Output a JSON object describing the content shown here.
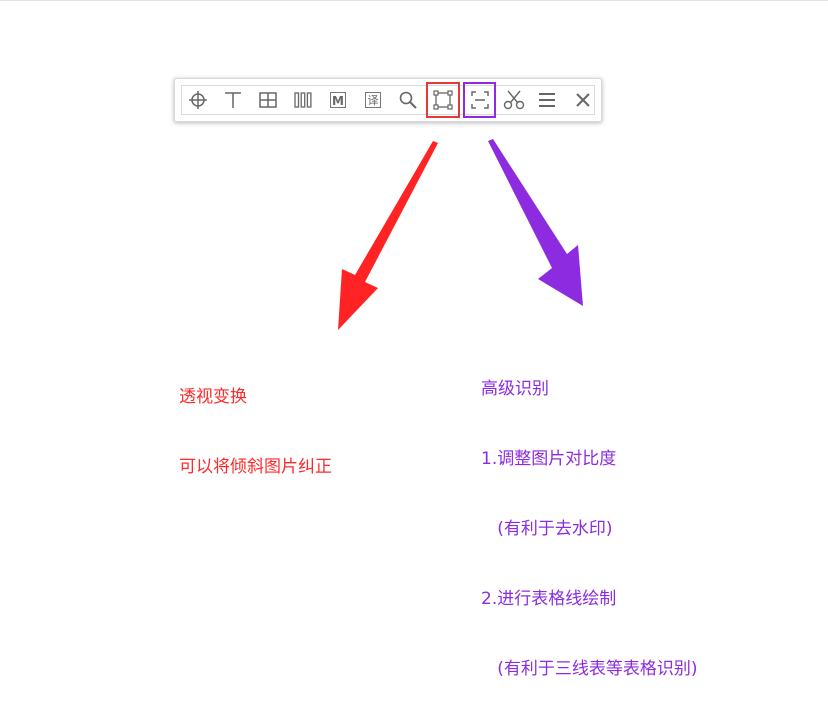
{
  "toolbar": {
    "tools": [
      {
        "name": "crosshair-icon"
      },
      {
        "name": "text-icon"
      },
      {
        "name": "grid-icon"
      },
      {
        "name": "columns-icon"
      },
      {
        "name": "letter-m-icon",
        "glyph": "M"
      },
      {
        "name": "translate-icon",
        "glyph": "译"
      },
      {
        "name": "search-icon"
      },
      {
        "name": "perspective-transform-icon"
      },
      {
        "name": "advanced-recognition-icon"
      },
      {
        "name": "scissors-icon"
      },
      {
        "name": "menu-icon"
      },
      {
        "name": "close-icon"
      }
    ],
    "highlight_colors": {
      "perspective": "#e53935",
      "advanced": "#8c2be0"
    }
  },
  "annotations": {
    "perspective": {
      "color": "#ff2a2a",
      "lines": [
        "透视变换",
        "可以将倾斜图片纠正"
      ]
    },
    "advanced": {
      "color": "#8c2be0",
      "lines": [
        "高级识别",
        "1.调整图片对比度",
        "   (有利于去水印)",
        "2.进行表格线绘制",
        "   (有利于三线表等表格识别)"
      ]
    }
  }
}
